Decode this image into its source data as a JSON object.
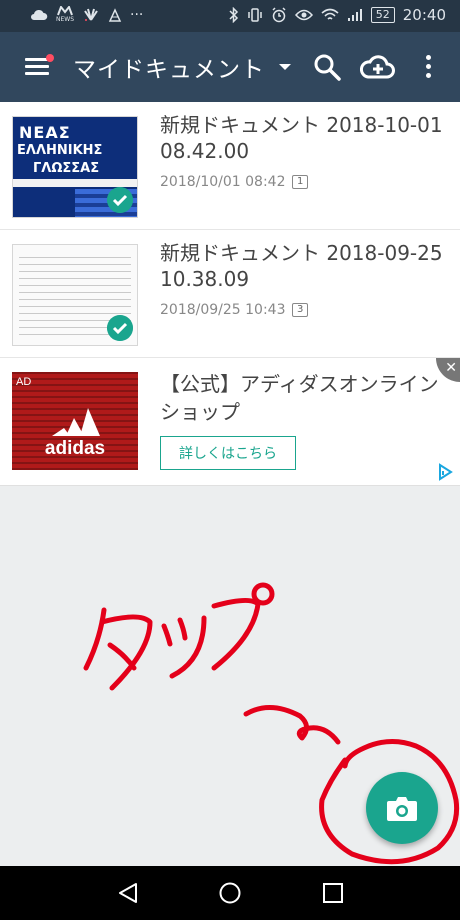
{
  "status_bar": {
    "left_icons": [
      "cloud-icon",
      "news-icon",
      "huawei-icon",
      "more-dots"
    ],
    "news_label": "NEWS",
    "more": "···",
    "battery": "52",
    "time": "20:40"
  },
  "toolbar": {
    "title": "マイドキュメント",
    "icons": [
      "menu-icon",
      "dropdown-caret-icon",
      "search-icon",
      "cloud-upload-icon",
      "more-vert-icon"
    ]
  },
  "documents": [
    {
      "title": "新規ドキュメント 2018-10-01 08.42.00",
      "date": "2018/10/01 08:42",
      "pages": "1"
    },
    {
      "title": "新規ドキュメント 2018-09-25 10.38.09",
      "date": "2018/09/25 10:43",
      "pages": "3"
    }
  ],
  "thumb_greek": {
    "line1": "ΝΕΑΣ",
    "line2": "ΕΛΛΗΝΙΚΗΣ",
    "line3": "ΓΛΩΣΣΑΣ"
  },
  "ad": {
    "label": "AD",
    "brand": "adidas",
    "title": "【公式】アディダスオンラインショップ",
    "button": "詳しくはこちら",
    "close": "✕"
  },
  "colors": {
    "status_bar": "#263645",
    "toolbar": "#31475d",
    "accent": "#1aa58e",
    "annotation": "#e4001a"
  }
}
